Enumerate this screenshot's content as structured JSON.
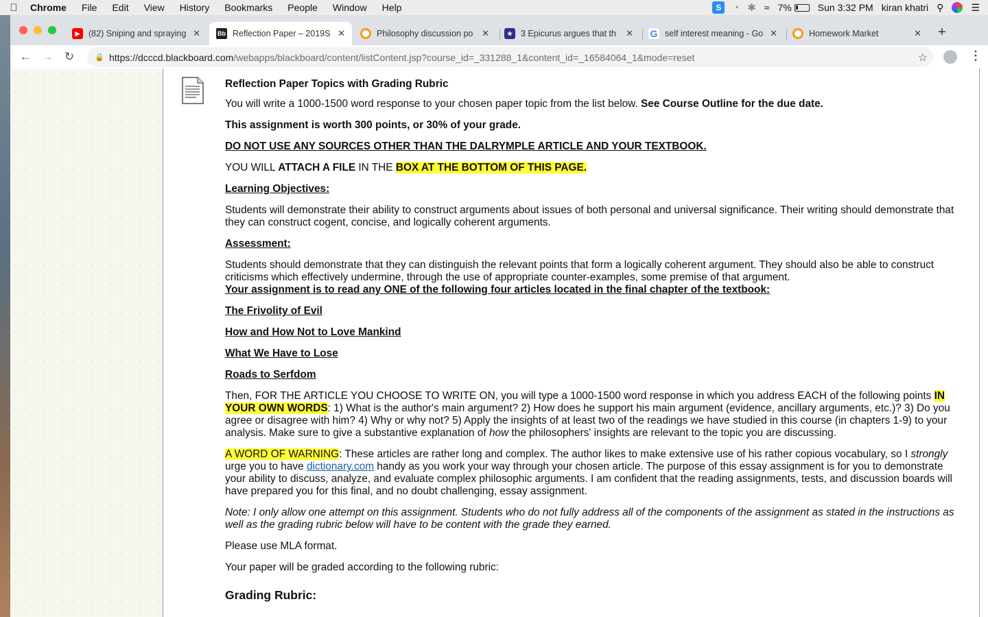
{
  "menubar": {
    "app_name": "Chrome",
    "menus": [
      "File",
      "Edit",
      "View",
      "History",
      "Bookmarks",
      "People",
      "Window",
      "Help"
    ],
    "battery": "7%",
    "clock": "Sun 3:32 PM",
    "user": "kiran khatri"
  },
  "tabs": [
    {
      "title": "(82) Sniping and spraying",
      "favicon": "youtube-icon",
      "color": "#ff0000"
    },
    {
      "title": "Reflection Paper – 2019S",
      "favicon": "blackboard-icon",
      "color": "#222222",
      "glyph": "Bb"
    },
    {
      "title": "Philosophy discussion po",
      "favicon": "homework-market-icon",
      "color": "#f39c12"
    },
    {
      "title": "3 Epicurus argues that th",
      "favicon": "star-badge-icon",
      "color": "#2b2f8f"
    },
    {
      "title": "self interest meaning - Go",
      "favicon": "google-icon",
      "color": "#4285f4",
      "glyph": "G"
    },
    {
      "title": "Homework Market",
      "favicon": "homework-market-icon",
      "color": "#f39c12"
    }
  ],
  "address": {
    "host": "https://dcccd.blackboard.com",
    "path": "/webapps/blackboard/content/listContent.jsp?course_id=_331288_1&content_id=_16584064_1&mode=reset"
  },
  "content": {
    "title": "Reflection Paper Topics with Grading Rubric",
    "intro_a": "You will write a 1000-1500 word response to your chosen paper topic from the list below. ",
    "intro_b": "See Course Outline for the due date.",
    "worth": "This assignment is worth 300 points, or 30% of your grade.",
    "sources": "DO NOT USE ANY SOURCES OTHER THAN THE DALRYMPLE ARTICLE AND YOUR TEXTBOOK.",
    "attach_a": "YOU WILL ",
    "attach_b": "ATTACH A FILE",
    "attach_c": " IN THE ",
    "attach_d": "BOX AT THE BOTTOM OF THIS PAGE.",
    "objectives_heading": "Learning Objectives:",
    "objectives_text": "Students will demonstrate their ability to construct arguments about issues of both personal and universal significance. Their writing should demonstrate that they can construct cogent, concise, and logically coherent arguments.",
    "assessment_heading": "Assessment:",
    "assessment_text": "Students should demonstrate that they can distinguish the relevant points that form a logically coherent argument. They should also be able to construct criticisms which effectively undermine, through the use of appropriate counter-examples, some premise of that argument.",
    "assignment_line": "Your assignment is to read any ONE of the following four articles located in the final chapter of the textbook:",
    "articles": [
      "The Frivolity of Evil",
      "How and How Not to Love Mankind",
      "What We Have to Lose",
      "Roads to Serfdom"
    ],
    "then_a": "Then, FOR THE ARTICLE YOU CHOOSE TO WRITE ON, you will type a 1000-1500 word response in which you address EACH of the following points ",
    "then_hl": "IN YOUR OWN WORDS",
    "then_b": ": 1) What is the author's main argument? 2) How does he support his main argument (evidence, ancillary arguments, etc.)? 3) Do you agree or disagree with him? 4) Why or why not? 5) Apply the insights of at least two of the readings we have studied in this course (in chapters 1-9) to your analysis. Make sure to give a substantive explanation of ",
    "then_i": "how",
    "then_c": " the philosophers' insights are relevant to the topic you are discussing.",
    "warn_hl": "A WORD OF WARNING",
    "warn_a": ": These articles are rather long and complex. The author likes to make extensive use of his rather copious vocabulary, so I ",
    "warn_i": "strongly",
    "warn_b": " urge you to have ",
    "warn_link": "dictionary.com",
    "warn_c": " handy as you work your way through your chosen article. The purpose of this essay assignment is for you to demonstrate your ability to discuss, analyze, and evaluate complex philosophic arguments. I am confident that the reading assignments, tests, and discussion boards will have prepared you for this final, and no doubt challenging, essay assignment.",
    "note": "Note: I only allow one attempt on this assignment. Students who do not fully address all of the components of the assignment as stated in the instructions as well as the grading rubric below will have to be content with the grade they earned.",
    "mla": "Please use MLA format.",
    "graded": "Your paper will be graded according to the following rubric:",
    "rubric_heading": "Grading Rubric:"
  },
  "colors": {
    "highlight": "#ffff33",
    "link": "#1a5fa6"
  }
}
